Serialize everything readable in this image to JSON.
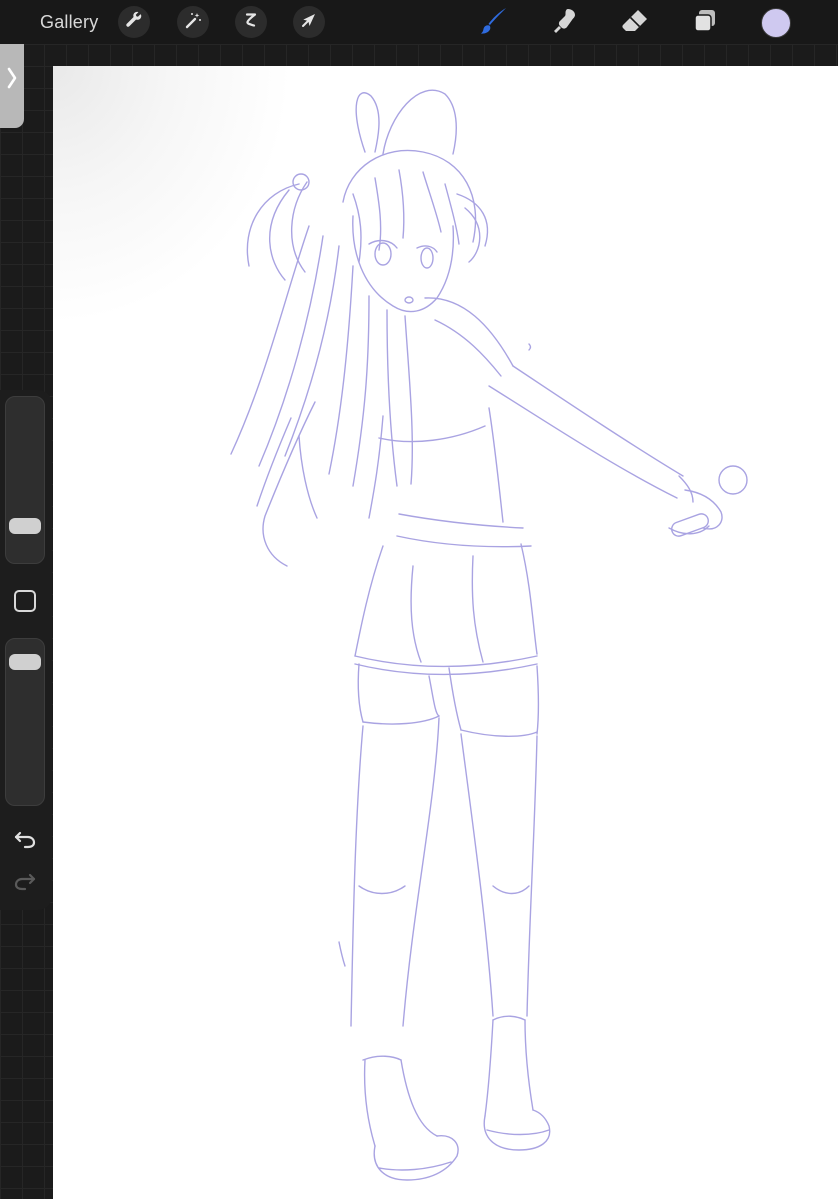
{
  "topbar": {
    "gallery_label": "Gallery",
    "left_tools": [
      {
        "icon": "wrench-icon",
        "name": "actions"
      },
      {
        "icon": "magic-wand-icon",
        "name": "adjustments"
      },
      {
        "icon": "s-curve-icon",
        "name": "selection"
      },
      {
        "icon": "arrow-cursor-icon",
        "name": "transform"
      }
    ],
    "right_tools": [
      {
        "icon": "brush-icon",
        "name": "brush",
        "active": true
      },
      {
        "icon": "smudge-icon",
        "name": "smudge"
      },
      {
        "icon": "eraser-icon",
        "name": "eraser"
      },
      {
        "icon": "layers-icon",
        "name": "layers"
      }
    ],
    "current_color": "#cfc9f0"
  },
  "sidebar": {
    "toggle_icon": "chevron-right-icon",
    "brush_size_level": 0.18,
    "opacity_level": 0.92,
    "modify_icon": "square-icon",
    "undo_icon": "undo-arrow-icon",
    "redo_icon": "redo-arrow-icon"
  },
  "colors": {
    "background": "#1b1b1b",
    "topbar": "#181818",
    "active_tool": "#2f6bde",
    "sketch_stroke": "#9b94dd",
    "canvas": "#ffffff"
  }
}
